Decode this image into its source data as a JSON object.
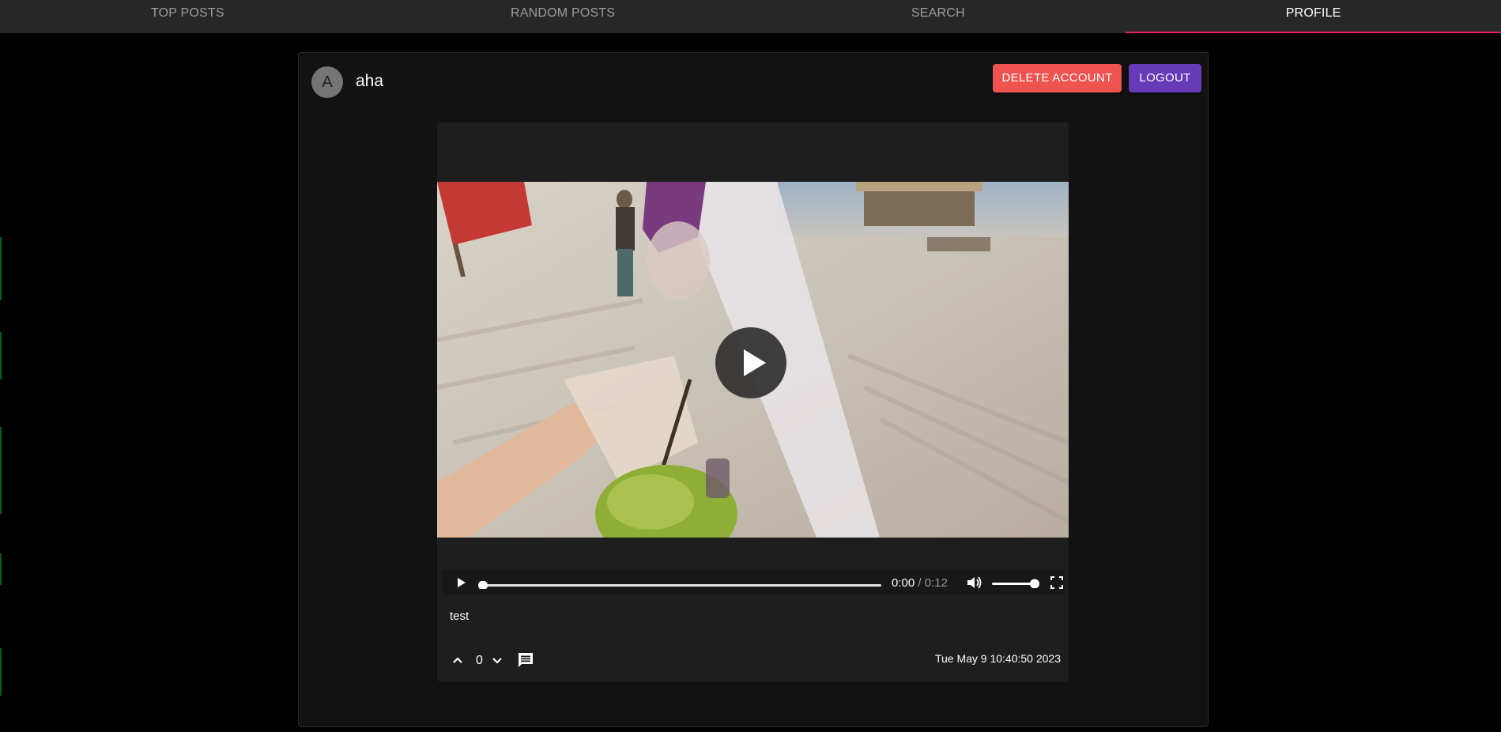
{
  "nav": {
    "tabs": [
      {
        "label": "TOP POSTS"
      },
      {
        "label": "RANDOM POSTS"
      },
      {
        "label": "SEARCH"
      },
      {
        "label": "PROFILE"
      }
    ],
    "active_tab": "PROFILE",
    "accent_color": "#e91e63"
  },
  "profile": {
    "avatar_letter": "A",
    "username": "aha",
    "delete_label": "DELETE ACCOUNT",
    "logout_label": "LOGOUT",
    "delete_color": "#ef5350",
    "logout_color": "#673ab7"
  },
  "post": {
    "video": {
      "current_time": "0:00",
      "duration": "0:12",
      "progress": 0,
      "volume": 1
    },
    "caption": "test",
    "score": "0",
    "date": "Tue May 9 10:40:50 2023",
    "icons": [
      "play-icon",
      "volume-icon",
      "fullscreen-icon",
      "upvote-icon",
      "downvote-icon",
      "comment-icon"
    ]
  }
}
